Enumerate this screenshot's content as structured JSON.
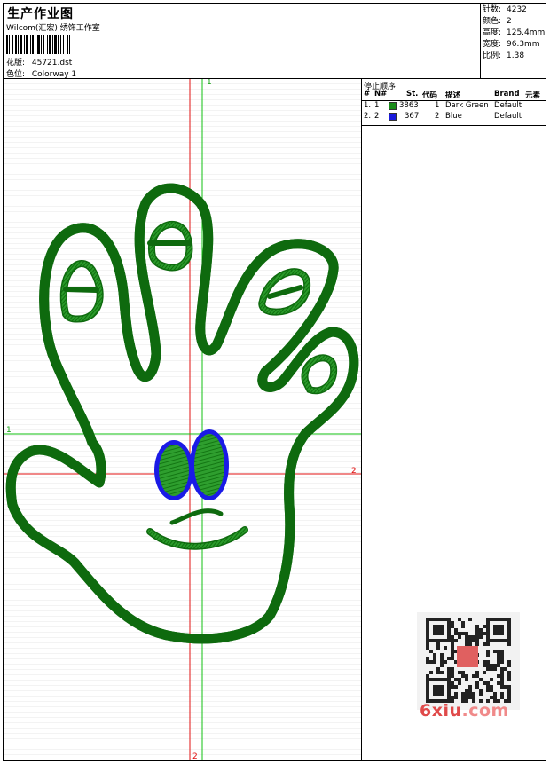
{
  "header": {
    "title": "生产作业图",
    "company": "Wilcom(汇宏) 绣饰工作室",
    "design_label": "花版:",
    "design_value": "45721.dst",
    "colorway_label": "色位:",
    "colorway_value": "Colorway 1"
  },
  "stats": [
    {
      "label": "针数:",
      "value": "4232"
    },
    {
      "label": "颜色:",
      "value": "2"
    },
    {
      "label": "高度:",
      "value": "125.4mm"
    },
    {
      "label": "宽度:",
      "value": "96.3mm"
    },
    {
      "label": "比例:",
      "value": "1.38"
    }
  ],
  "canvas": {
    "marker_v_green": "1",
    "marker_h_green": "1",
    "marker_h_red": "2",
    "marker_v_red": "2"
  },
  "stop_sequence": {
    "title": "停止顺序:",
    "columns": [
      "#",
      "N#",
      "St.",
      "代码",
      "描述",
      "Brand",
      "元素"
    ],
    "rows": [
      {
        "num": "1.",
        "n": "1",
        "color": "#1a8c1a",
        "stitches": "3863",
        "code": "1",
        "desc": "Dark Green",
        "brand": "Default"
      },
      {
        "num": "2.",
        "n": "2",
        "color": "#1a1adc",
        "stitches": "367",
        "code": "2",
        "desc": "Blue",
        "brand": "Default"
      }
    ]
  },
  "watermark": {
    "url_main": "6xiu",
    "url_dot": ".com"
  },
  "colors": {
    "thread_green": "#1e8f1e",
    "thread_blue": "#1a1ae6",
    "guide_red": "#e01010",
    "guide_green": "#10c010"
  }
}
